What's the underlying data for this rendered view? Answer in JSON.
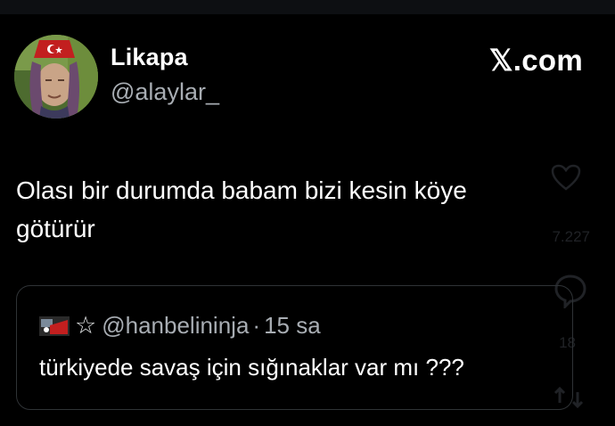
{
  "author": {
    "display_name": "Likapa",
    "handle": "@alaylar_"
  },
  "brand": "𝕏.com",
  "tweet": {
    "text_line1": "Olası bir durumda babam bizi kesin köye",
    "text_line2": "götürür"
  },
  "actions": {
    "like_count": "7.227",
    "reply_count": "18",
    "like_icon": "heart-icon",
    "reply_icon": "comment-icon",
    "retweet_icon": "retweet-icon"
  },
  "quote": {
    "star": "☆",
    "handle": "@hanbelininja",
    "separator": "·",
    "time": "15 sa",
    "text": "türkiyede savaş için sığınaklar var mı ???"
  },
  "colors": {
    "background": "#000000",
    "secondary_text": "#a8adb3",
    "border": "#2f3336"
  }
}
